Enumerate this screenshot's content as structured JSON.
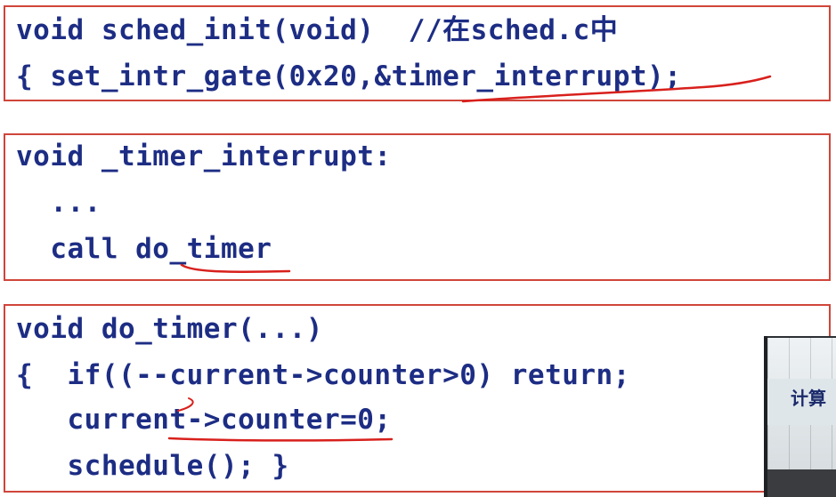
{
  "boxes": [
    {
      "lines": [
        "void sched_init(void)  //在sched.c中",
        "{ set_intr_gate(0x20,&timer_interrupt);"
      ]
    },
    {
      "lines": [
        "void _timer_interrupt:",
        "  ...",
        "  call do_timer"
      ]
    },
    {
      "lines": [
        "void do_timer(...)",
        "{  if((--current->counter>0) return;",
        "   current->counter=0;",
        "   schedule(); }"
      ]
    }
  ],
  "video": {
    "sign_text": "计算"
  },
  "colors": {
    "border": "#d0453a",
    "code": "#1d2d84",
    "annotation": "#d8201c"
  }
}
